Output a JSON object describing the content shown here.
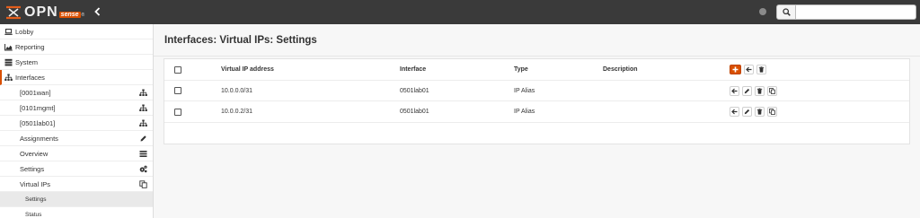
{
  "app": {
    "logo_text": "OPN",
    "logo_sense": "sense",
    "logo_reg": "®"
  },
  "header": {
    "search_placeholder": "",
    "search_value": ""
  },
  "sidebar": {
    "top_items": [
      {
        "label": "Lobby",
        "icon": "laptop-icon"
      },
      {
        "label": "Reporting",
        "icon": "area-chart-icon"
      },
      {
        "label": "System",
        "icon": "server-icon"
      },
      {
        "label": "Interfaces",
        "icon": "sitemap-icon"
      }
    ],
    "interfaces_items": [
      {
        "label": "[0001wan]",
        "icon": "sitemap-icon"
      },
      {
        "label": "[0101mgmt]",
        "icon": "sitemap-icon"
      },
      {
        "label": "[0501lab01]",
        "icon": "sitemap-icon"
      },
      {
        "label": "Assignments",
        "icon": "pencil-icon"
      },
      {
        "label": "Overview",
        "icon": "list-icon"
      },
      {
        "label": "Settings",
        "icon": "cogs-icon"
      },
      {
        "label": "Virtual IPs",
        "icon": "copy-icon"
      }
    ],
    "virtual_ips_items": [
      {
        "label": "Settings"
      },
      {
        "label": "Status"
      }
    ]
  },
  "page": {
    "title": "Interfaces: Virtual IPs: Settings"
  },
  "table": {
    "columns": [
      "Virtual IP address",
      "Interface",
      "Type",
      "Description"
    ],
    "rows": [
      {
        "address": "10.0.0.0/31",
        "interface": "0501lab01",
        "type": "IP Alias",
        "description": ""
      },
      {
        "address": "10.0.0.2/31",
        "interface": "0501lab01",
        "type": "IP Alias",
        "description": ""
      }
    ]
  },
  "colors": {
    "accent": "#d94f00",
    "topbar": "#3a3a3a"
  }
}
